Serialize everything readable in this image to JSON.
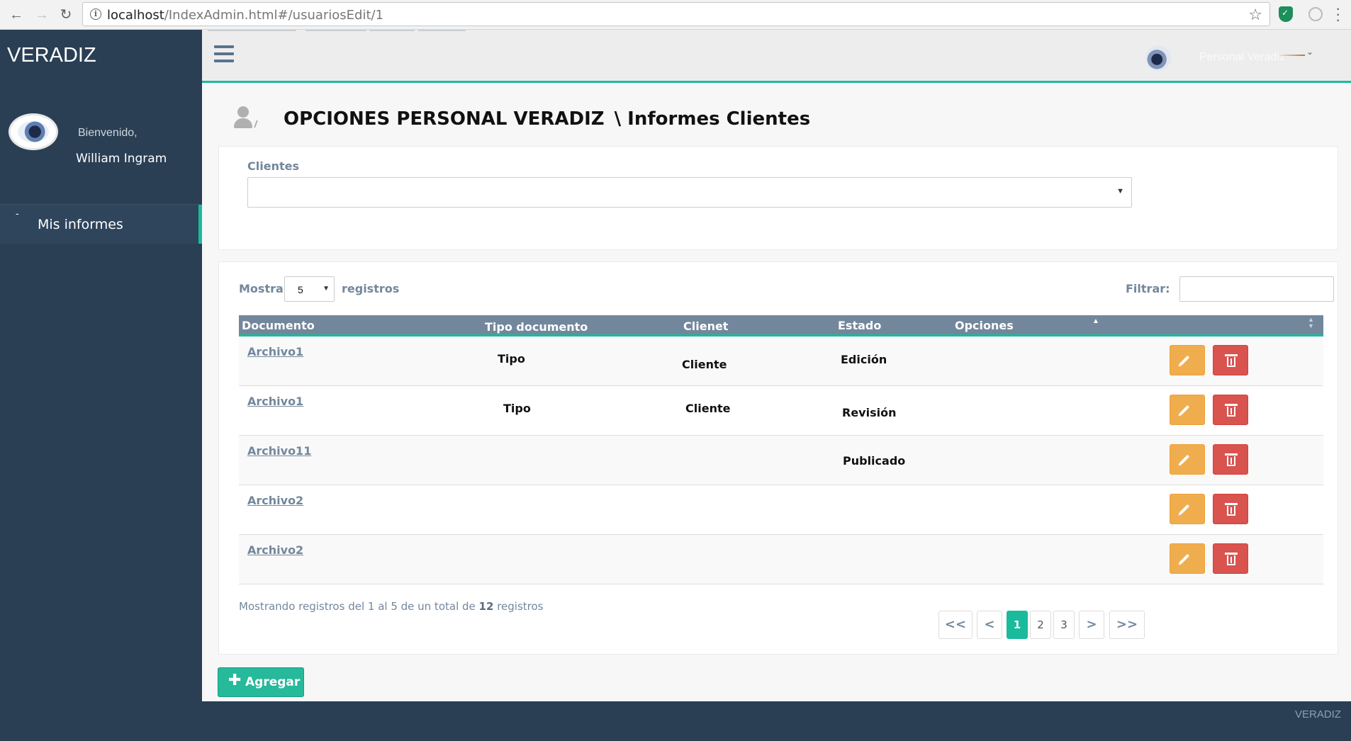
{
  "browser": {
    "url_host": "localhost",
    "url_path": "/IndexAdmin.html#/usuariosEdit/1"
  },
  "sidebar": {
    "brand": "VERADIZ",
    "welcome": "Bienvenido,",
    "username": "William Ingram",
    "items": [
      {
        "label": "Mis informes"
      }
    ]
  },
  "topnav": {
    "user": "Personal Veradiz"
  },
  "page": {
    "title": "OPCIONES PERSONAL VERADIZ",
    "subtitle": "\\ Informes Clientes"
  },
  "filters": {
    "clientes_label": "Clientes",
    "clientes_value": ""
  },
  "table_controls": {
    "show_label": "Mostrar",
    "show_value": "5",
    "records_label": "registros",
    "filter_label": "Filtrar:",
    "filter_value": ""
  },
  "table": {
    "columns": [
      "Documento",
      "Tipo documento",
      "Clienet",
      "Estado",
      "Opciones"
    ],
    "rows": [
      {
        "documento": "Archivo1",
        "tipo": "Tipo",
        "cliente": "Cliente",
        "estado": "Edición"
      },
      {
        "documento": "Archivo1",
        "tipo": "Tipo",
        "cliente": "Cliente",
        "estado": "Revisión"
      },
      {
        "documento": "Archivo11",
        "tipo": "",
        "cliente": "",
        "estado": "Publicado"
      },
      {
        "documento": "Archivo2",
        "tipo": "",
        "cliente": "",
        "estado": ""
      },
      {
        "documento": "Archivo2",
        "tipo": "",
        "cliente": "",
        "estado": ""
      }
    ]
  },
  "pagination": {
    "info_prefix": "Mostrando registros del 1 al 5 de un total de",
    "info_total": "12",
    "info_suffix": "registros",
    "first": "<<",
    "prev": "<",
    "pages": [
      "1",
      "2",
      "3"
    ],
    "active_page": "1",
    "next": ">",
    "last": ">>"
  },
  "actions": {
    "add_label": "Agregar"
  },
  "footer": {
    "brand": "VERADIZ"
  },
  "colors": {
    "sidebar_bg": "#2a3f54",
    "accent": "#1abb9c",
    "header_bg": "#73879c",
    "edit_button": "#f0ad4e",
    "delete_button": "#d9534f"
  },
  "icons": {
    "menu": "hamburger-icon",
    "user": "user-icon",
    "edit": "pencil-icon",
    "delete": "trash-icon",
    "add": "plus-icon"
  }
}
